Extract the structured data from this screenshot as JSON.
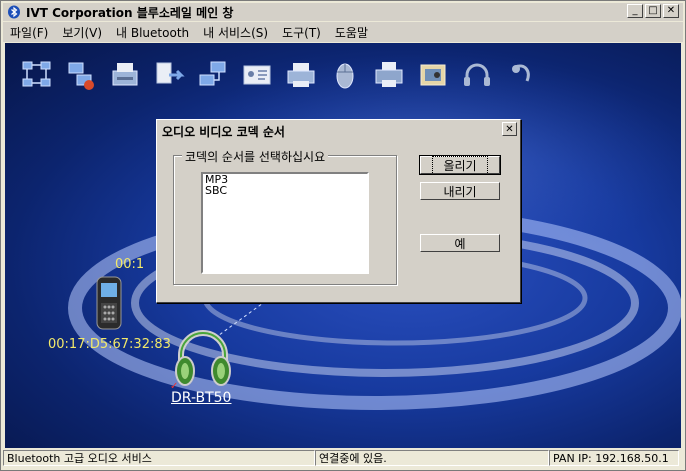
{
  "window": {
    "title": "IVT Corporation 블루소레일 메인 창",
    "controls": [
      "_",
      "□",
      "✕"
    ]
  },
  "menubar": {
    "items": [
      "파일(F)",
      "보기(V)",
      "내 Bluetooth",
      "내 서비스(S)",
      "도구(T)",
      "도움말"
    ]
  },
  "toolbar": {
    "icons": [
      "network-tree-icon",
      "network-pc-icon",
      "fax-icon",
      "file-transfer-icon",
      "lan-access-icon",
      "business-card-icon",
      "printer-icon",
      "mouse-icon",
      "printer2-icon",
      "image-icon",
      "headphones-icon",
      "headset-icon"
    ]
  },
  "devices": {
    "phone_label_partial": "00:1",
    "phone_address": "00:17:D5:67:32:83",
    "headset_label": "DR-BT50"
  },
  "dialog": {
    "title": "오디오 비디오 코덱 순서",
    "close": "✕",
    "group_label": "코덱의 순서를 선택하십시요",
    "codecs": [
      "MP3",
      "SBC"
    ],
    "up_button": "올리기",
    "down_button": "내리기",
    "ok_button": "예"
  },
  "statusbar": {
    "service": "Bluetooth 고급 오디오 서비스",
    "connection": "연결중에 있음.",
    "pan_ip": "PAN IP: 192.168.50.1"
  }
}
